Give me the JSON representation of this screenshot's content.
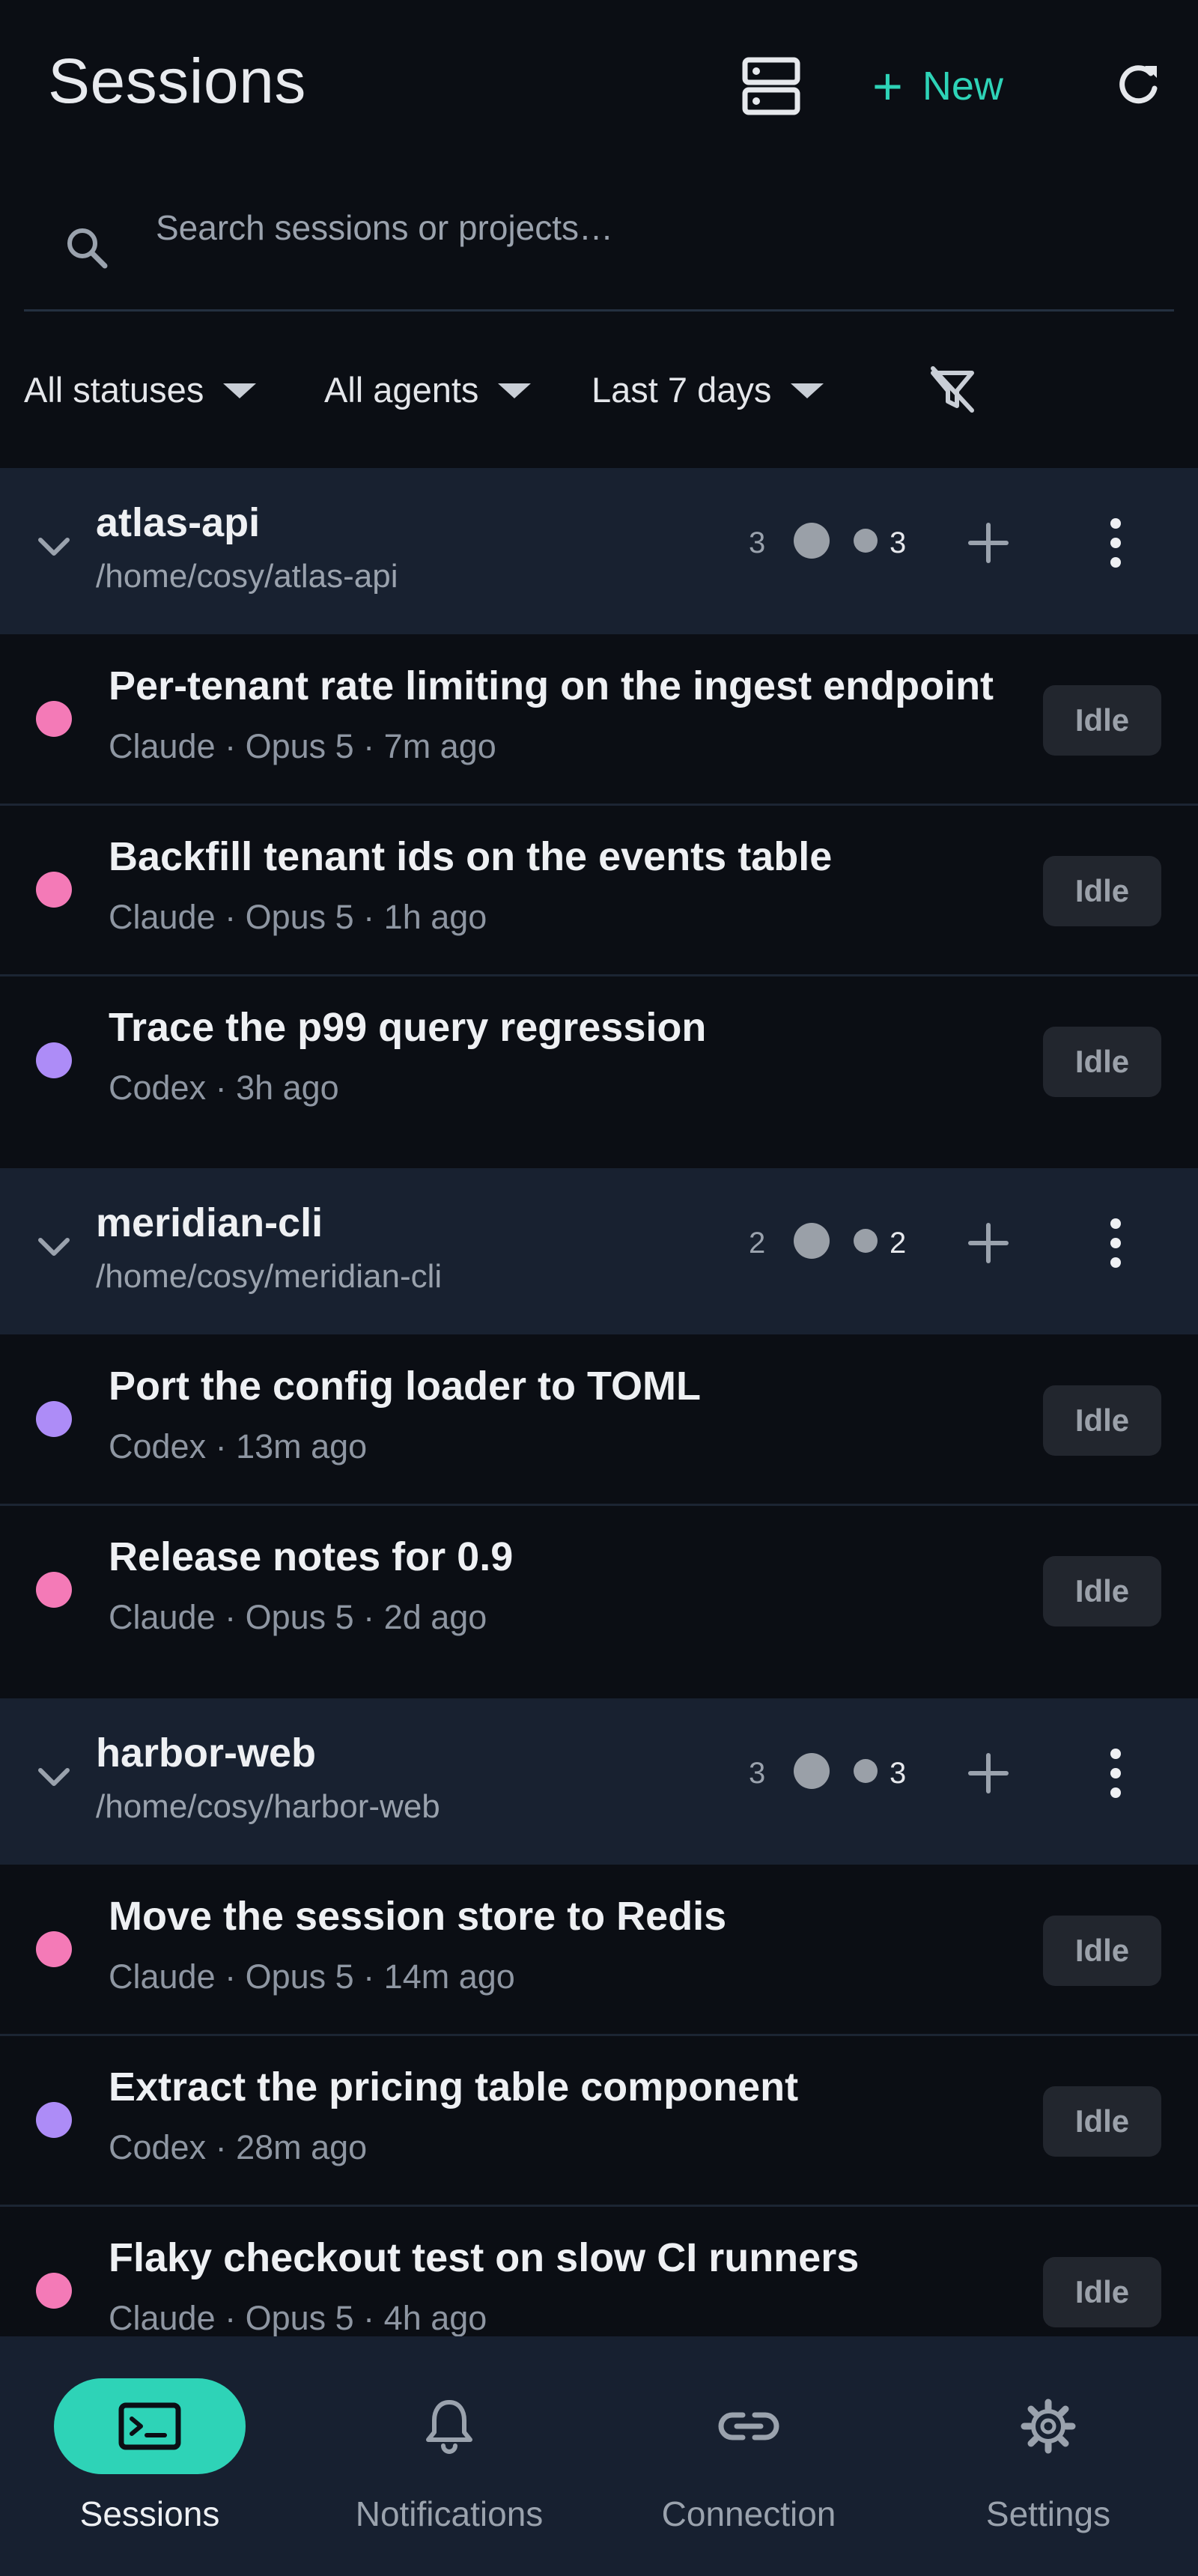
{
  "header": {
    "title": "Sessions",
    "new_label": "New"
  },
  "search": {
    "placeholder": "Search sessions or projects…"
  },
  "filters": {
    "status": "All statuses",
    "agents": "All agents",
    "range": "Last 7 days"
  },
  "colors": {
    "accent": "#2ed3b7",
    "claude_dot": "#f47ab7",
    "codex_dot": "#ad8cf7",
    "idle_badge": "#22262e"
  },
  "groups": [
    {
      "name": "atlas-api",
      "path": "/home/cosy/atlas-api",
      "count": "3",
      "idle_count": "3",
      "sessions": [
        {
          "title": "Per-tenant rate limiting on the ingest endpoint",
          "meta": "Claude · Opus 5 · 7m ago",
          "status": "Idle",
          "agent": "claude"
        },
        {
          "title": "Backfill tenant ids on the events table",
          "meta": "Claude · Opus 5 · 1h ago",
          "status": "Idle",
          "agent": "claude"
        },
        {
          "title": "Trace the p99 query regression",
          "meta": "Codex · 3h ago",
          "status": "Idle",
          "agent": "codex"
        }
      ]
    },
    {
      "name": "meridian-cli",
      "path": "/home/cosy/meridian-cli",
      "count": "2",
      "idle_count": "2",
      "sessions": [
        {
          "title": "Port the config loader to TOML",
          "meta": "Codex · 13m ago",
          "status": "Idle",
          "agent": "codex"
        },
        {
          "title": "Release notes for 0.9",
          "meta": "Claude · Opus 5 · 2d ago",
          "status": "Idle",
          "agent": "claude"
        }
      ]
    },
    {
      "name": "harbor-web",
      "path": "/home/cosy/harbor-web",
      "count": "3",
      "idle_count": "3",
      "sessions": [
        {
          "title": "Move the session store to Redis",
          "meta": "Claude · Opus 5 · 14m ago",
          "status": "Idle",
          "agent": "claude"
        },
        {
          "title": "Extract the pricing table component",
          "meta": "Codex · 28m ago",
          "status": "Idle",
          "agent": "codex"
        },
        {
          "title": "Flaky checkout test on slow CI runners",
          "meta": "Claude · Opus 5 · 4h ago",
          "status": "Idle",
          "agent": "claude"
        }
      ]
    }
  ],
  "tabs": [
    {
      "label": "Sessions",
      "icon": "terminal-icon",
      "active": true
    },
    {
      "label": "Notifications",
      "icon": "bell-icon",
      "active": false
    },
    {
      "label": "Connection",
      "icon": "link-icon",
      "active": false
    },
    {
      "label": "Settings",
      "icon": "gear-icon",
      "active": false
    }
  ]
}
